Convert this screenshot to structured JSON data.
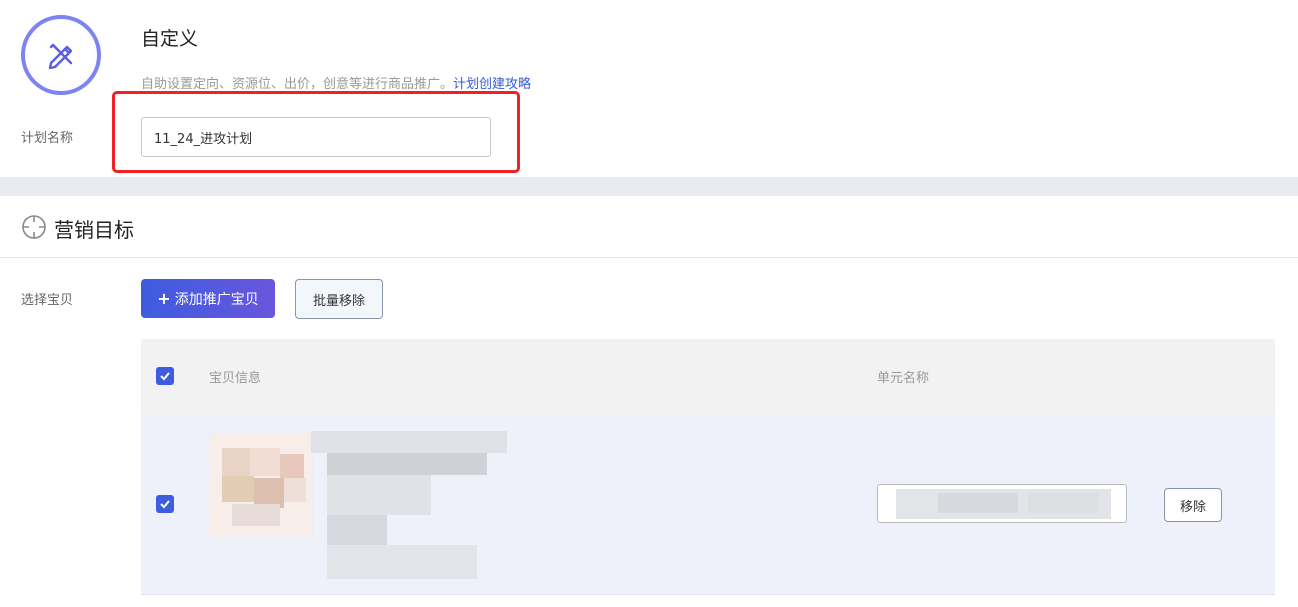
{
  "header": {
    "title": "自定义",
    "description": "自助设置定向、资源位、出价，创意等进行商品推广。",
    "guide_link": "计划创建攻略"
  },
  "plan_name": {
    "label": "计划名称",
    "value": "11_24_进攻计划"
  },
  "marketing_section": {
    "title": "营销目标",
    "select_label": "选择宝贝",
    "add_button": "添加推广宝贝",
    "add_button_icon": "+",
    "batch_remove_button": "批量移除"
  },
  "table": {
    "columns": [
      "宝贝信息",
      "单元名称"
    ],
    "rows": [
      {
        "checked": true,
        "remove_label": "移除"
      }
    ]
  },
  "colors": {
    "accent": "#3d5ce0",
    "highlight": "#ee2222",
    "band": "#e8ebf0"
  }
}
